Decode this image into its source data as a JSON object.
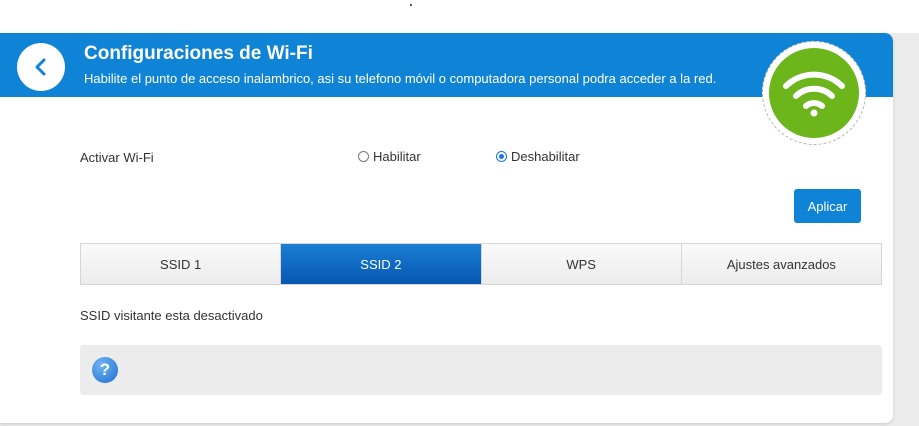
{
  "header": {
    "title": "Configuraciones de Wi-Fi",
    "description": "Habilite el punto de acceso inalambrico, asi su telefono móvil o computadora personal podra acceder a la red.",
    "back_icon": "chevron-left-icon",
    "badge_icon": "wifi-icon",
    "badge_color": "#6cb51b",
    "accent_color": "#0f84d6"
  },
  "wifi_toggle": {
    "label": "Activar Wi-Fi",
    "options": [
      {
        "label": "Habilitar",
        "selected": false
      },
      {
        "label": "Deshabilitar",
        "selected": true
      }
    ]
  },
  "apply_label": "Aplicar",
  "tabs": [
    {
      "label": "SSID 1",
      "active": false
    },
    {
      "label": "SSID 2",
      "active": true
    },
    {
      "label": "WPS",
      "active": false
    },
    {
      "label": "Ajustes avanzados",
      "active": false
    }
  ],
  "status_text": "SSID visitante esta desactivado",
  "help": {
    "icon": "help-icon",
    "glyph": "?"
  }
}
